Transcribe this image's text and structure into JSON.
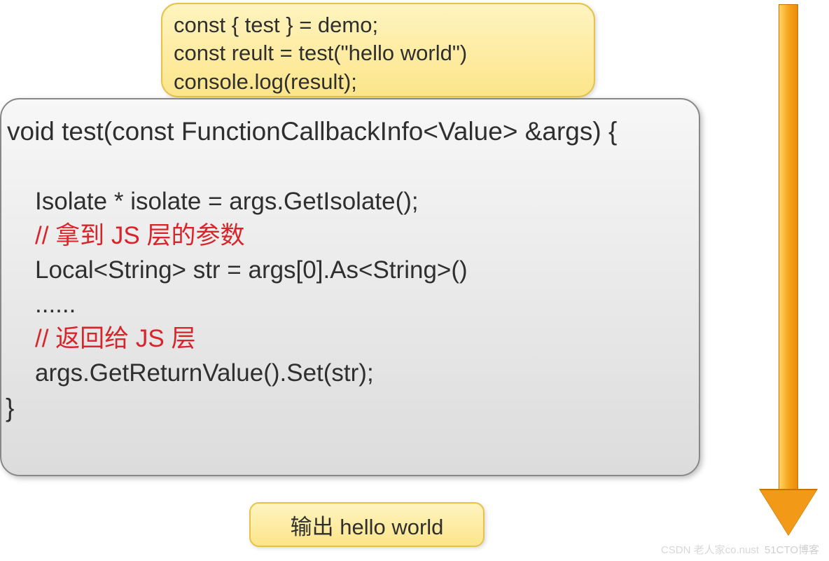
{
  "topBox": {
    "line1": "const { test } = demo;",
    "line2": "const reult = test(\"hello world\")",
    "line3": "console.log(result);"
  },
  "mainBox": {
    "signature": "void test(const FunctionCallbackInfo<Value> &args) {",
    "blank1": " ",
    "line1": "Isolate * isolate = args.GetIsolate();",
    "comment1": "// 拿到 JS 层的参数",
    "line2": "Local<String> str = args[0].As<String>()",
    "dots": "......",
    "comment2": "// 返回给 JS 层",
    "line3": "args.GetReturnValue().Set(str);",
    "closingBrace": "}"
  },
  "bottomBox": {
    "label": "输出 hello world"
  },
  "watermarks": {
    "right": "51CTO博客",
    "left": "CSDN 老人家co.nust"
  }
}
